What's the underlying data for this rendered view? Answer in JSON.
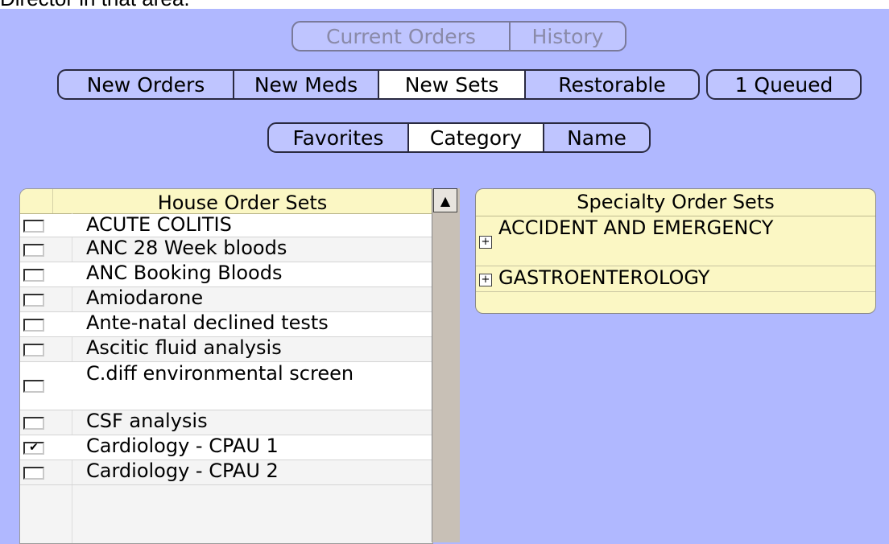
{
  "page": {
    "cut_text": "Director in that area."
  },
  "view_tabs": [
    {
      "label": "Current Orders",
      "active": false
    },
    {
      "label": "History",
      "active": false
    }
  ],
  "order_tabs": [
    {
      "label": "New Orders",
      "active": false
    },
    {
      "label": "New Meds",
      "active": false
    },
    {
      "label": "New Sets",
      "active": true
    },
    {
      "label": "Restorable",
      "active": false
    }
  ],
  "queued": {
    "label": "1 Queued"
  },
  "sort_tabs": [
    {
      "label": "Favorites",
      "active": false
    },
    {
      "label": "Category",
      "active": true
    },
    {
      "label": "Name",
      "active": false
    }
  ],
  "house_sets": {
    "title": "House Order Sets",
    "items": [
      {
        "label": "ACUTE COLITIS",
        "checked": false
      },
      {
        "label": "ANC 28 Week bloods",
        "checked": false
      },
      {
        "label": "ANC Booking Bloods",
        "checked": false
      },
      {
        "label": "Amiodarone",
        "checked": false
      },
      {
        "label": "Ante-natal declined tests",
        "checked": false
      },
      {
        "label": "Ascitic fluid analysis",
        "checked": false
      },
      {
        "label": "C.diff environmental screen",
        "checked": false
      },
      {
        "label": "CSF analysis",
        "checked": false
      },
      {
        "label": "Cardiology - CPAU 1",
        "checked": true
      },
      {
        "label": "Cardiology - CPAU 2",
        "checked": false
      }
    ]
  },
  "specialty_sets": {
    "title": "Specialty Order Sets",
    "items": [
      {
        "label": "ACCIDENT AND EMERGENCY",
        "icon": "expand-plus-icon"
      },
      {
        "label": "GASTROENTEROLOGY",
        "icon": "expand-plus-icon"
      }
    ]
  },
  "colors": {
    "background": "#b0b8ff",
    "header_yellow": "#fbf7c4",
    "active_tab": "#ffffff"
  }
}
